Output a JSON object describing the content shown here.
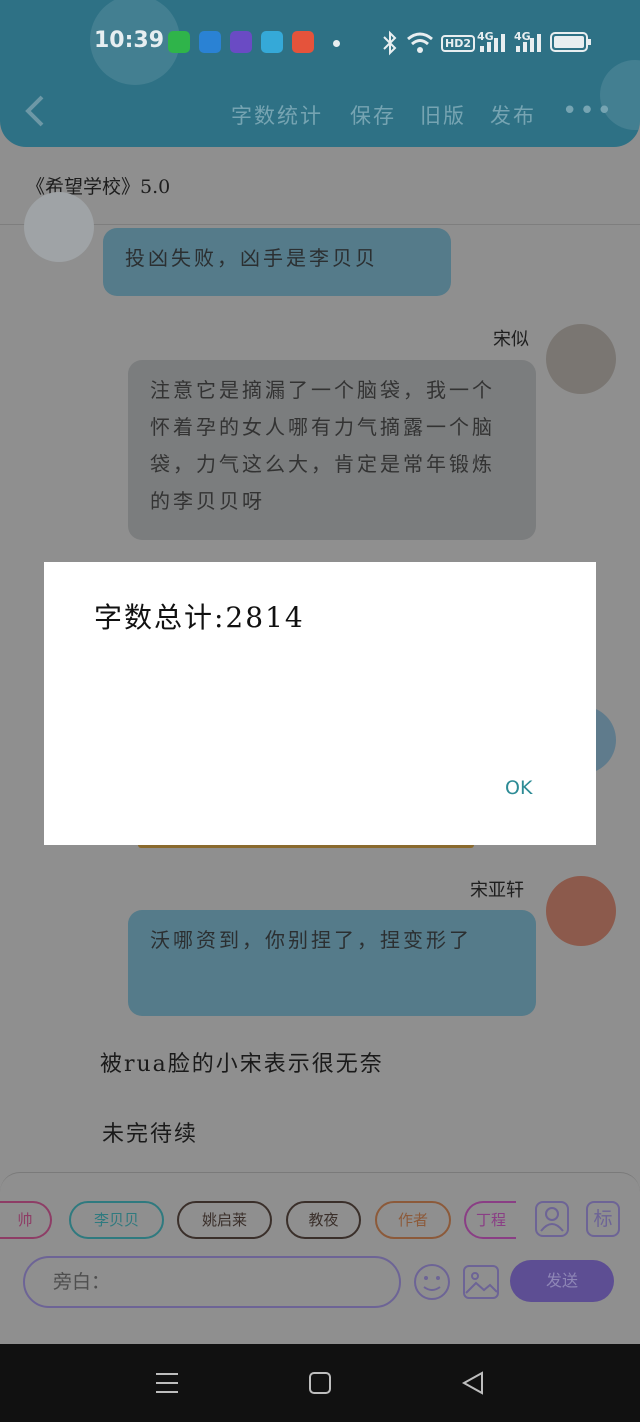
{
  "status_bar": {
    "time": "10:39",
    "hd": "HD2",
    "net1": "4G",
    "net2": "4G"
  },
  "header": {
    "menu": [
      "字数统计",
      "保存",
      "旧版",
      "发布"
    ],
    "more": "•••"
  },
  "book_title": "《希望学校》5.0",
  "messages": {
    "m1": "投凶失败，凶手是李贝贝",
    "name2": "宋似",
    "m2": "注意它是摘漏了一个脑袋，我一个怀着孕的女人哪有力气摘露一个脑袋，力气这么大，肯定是常年锻炼的李贝贝呀",
    "name3": "宋亚轩",
    "m3": "沃哪资到，你别捏了，捏变形了"
  },
  "narration": [
    "被rua脸的小宋表示很无奈",
    "未完待续"
  ],
  "characters": [
    "帅",
    "李贝贝",
    "姚启莱",
    "教夜",
    "作者",
    "丁程"
  ],
  "right_tools": {
    "tag": "标"
  },
  "input": {
    "placeholder": "旁白："
  },
  "send_label": "发送",
  "dialog": {
    "text": "字数总计:2814",
    "ok": "OK"
  },
  "colors": {
    "header": "#2e7185",
    "accent": "#5d4e93",
    "ok": "#2d8b95"
  }
}
